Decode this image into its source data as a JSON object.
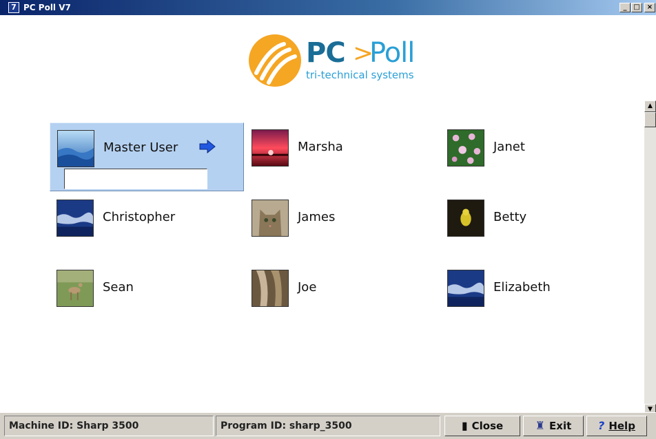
{
  "window": {
    "title": "PC Poll V7",
    "app_icon": "7",
    "controls": {
      "minimize": "_",
      "maximize": "□",
      "close": "×"
    }
  },
  "logo": {
    "pc": "PC",
    "arrow": ">",
    "poll": "Poll",
    "tagline": "tri-technical systems"
  },
  "users": [
    {
      "name": "Master User",
      "image": "blue-mountains",
      "selected": true
    },
    {
      "name": "Marsha",
      "image": "red-sunset",
      "selected": false
    },
    {
      "name": "Janet",
      "image": "pink-flowers",
      "selected": false
    },
    {
      "name": "Christopher",
      "image": "blue-waves",
      "selected": false
    },
    {
      "name": "James",
      "image": "tabby-cat",
      "selected": false
    },
    {
      "name": "Betty",
      "image": "yellow-frog",
      "selected": false
    },
    {
      "name": "Sean",
      "image": "deer-field",
      "selected": false
    },
    {
      "name": "Joe",
      "image": "horse",
      "selected": false
    },
    {
      "name": "Elizabeth",
      "image": "blue-waves",
      "selected": false
    }
  ],
  "password": {
    "value": "",
    "placeholder": ""
  },
  "status": {
    "machine_id": "Machine ID: Sharp 3500",
    "program_id": "Program ID: sharp_3500"
  },
  "buttons": {
    "close": "Close",
    "exit": "Exit",
    "help": "Help"
  },
  "colors": {
    "selected_bg": "#b5d1f1",
    "title_gradient_start": "#0a246a",
    "logo_orange": "#f5a623",
    "logo_blue": "#2a9fd6"
  }
}
